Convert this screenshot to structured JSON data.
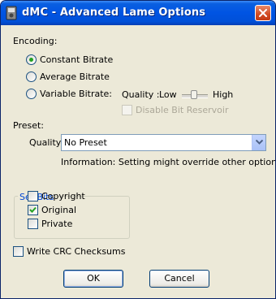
{
  "window": {
    "title": "dMC - Advanced Lame Options"
  },
  "encoding": {
    "label": "Encoding:",
    "constant_bitrate": "Constant Bitrate",
    "average_bitrate": "Average Bitrate",
    "variable_bitrate": "Variable Bitrate:",
    "selected": "constant_bitrate",
    "quality_label": "Quality :",
    "quality_low": "Low",
    "quality_high": "High",
    "disable_bit_reservoir": "Disable Bit Reservoir"
  },
  "preset": {
    "label": "Preset:",
    "quality_label": "Quality",
    "selected_value": "No Preset",
    "information": "Information: Setting might override other options"
  },
  "set_bits": {
    "title": "Set Bits",
    "copyright": {
      "label": "Copyright",
      "checked": false
    },
    "original": {
      "label": "Original",
      "checked": true
    },
    "private": {
      "label": "Private",
      "checked": false
    }
  },
  "write_crc": {
    "label": "Write CRC Checksums",
    "checked": false
  },
  "buttons": {
    "ok": "OK",
    "cancel": "Cancel"
  },
  "colors": {
    "titlebar": "#0054e3",
    "dialog_bg": "#ece9d8",
    "groupbox_title": "#0046d5",
    "radio_dot": "#21a121"
  }
}
